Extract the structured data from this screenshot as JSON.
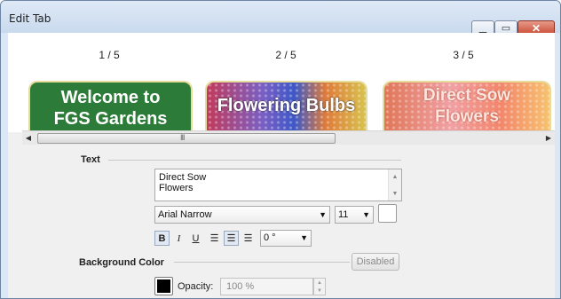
{
  "window": {
    "title": "Edit Tab"
  },
  "tabs": [
    {
      "number": "1 / 5",
      "lines": [
        "Welcome to",
        "FGS Gardens"
      ]
    },
    {
      "number": "2 / 5",
      "lines": [
        "Flowering Bulbs"
      ]
    },
    {
      "number": "3 / 5",
      "lines": [
        "Direct Sow",
        "Flowers"
      ]
    }
  ],
  "scrollbar": {
    "grip": "III"
  },
  "text_section": {
    "label": "Text",
    "textarea_lines": [
      "Direct Sow",
      "Flowers"
    ],
    "font": "Arial Narrow",
    "size": "11",
    "rotation": "0 °",
    "format_buttons": {
      "bold": "B",
      "italic": "I",
      "underline": "U"
    }
  },
  "background_section": {
    "label": "Background Color",
    "state_button": "Disabled",
    "opacity_label": "Opacity:",
    "opacity_value": "100 %"
  },
  "colors": {
    "tile1": "#2c7b38",
    "tile_border": "#e6dc9c",
    "swatch": "#000000"
  }
}
